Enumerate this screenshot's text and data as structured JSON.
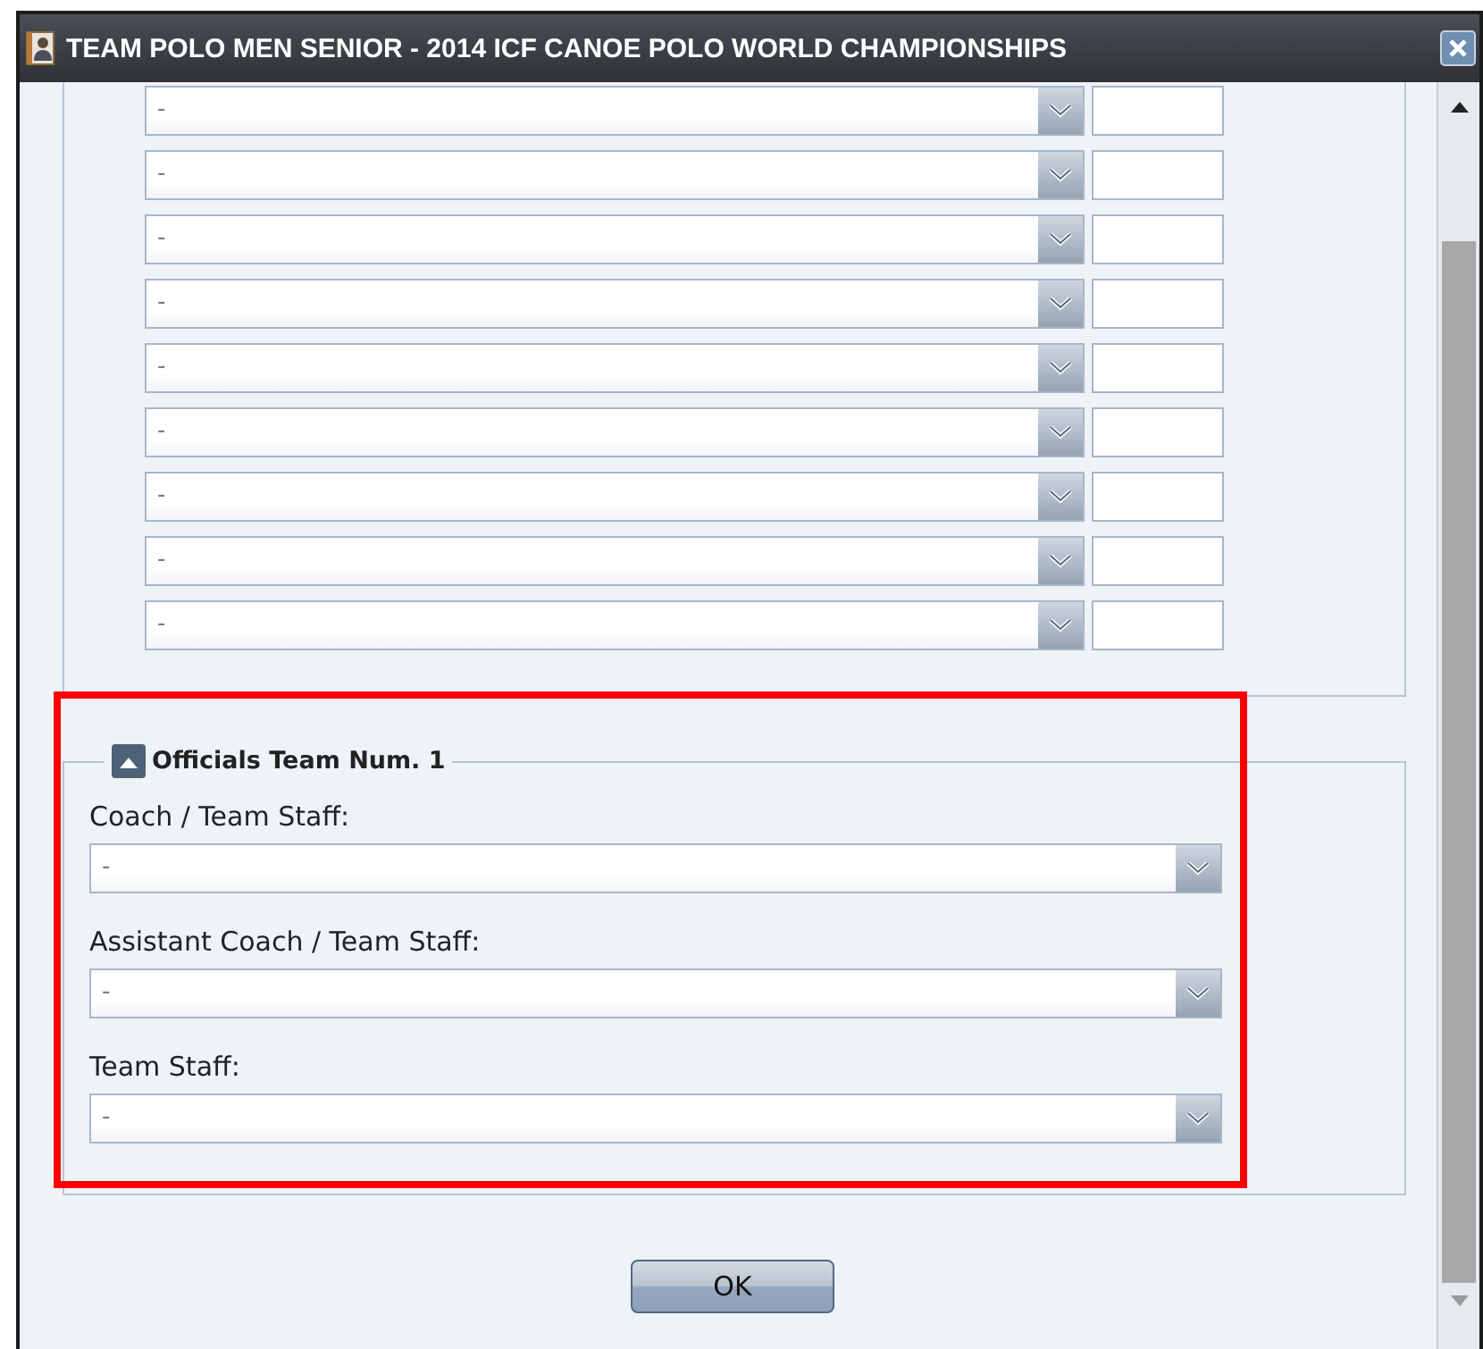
{
  "window": {
    "title": "TEAM POLO MEN SENIOR - 2014 ICF CANOE POLO WORLD CHAMPIONSHIPS"
  },
  "players": [
    {
      "value": "-"
    },
    {
      "value": "-"
    },
    {
      "value": "-"
    },
    {
      "value": "-"
    },
    {
      "value": "-"
    },
    {
      "value": "-"
    },
    {
      "value": "-"
    },
    {
      "value": "-"
    },
    {
      "value": "-"
    }
  ],
  "officials": {
    "legend": "Officials Team Num. 1",
    "expanded": true,
    "fields": [
      {
        "label": "Coach / Team Staff:",
        "value": "-"
      },
      {
        "label": "Assistant Coach / Team Staff:",
        "value": "-"
      },
      {
        "label": "Team Staff:",
        "value": "-"
      }
    ]
  },
  "buttons": [
    "OK"
  ]
}
